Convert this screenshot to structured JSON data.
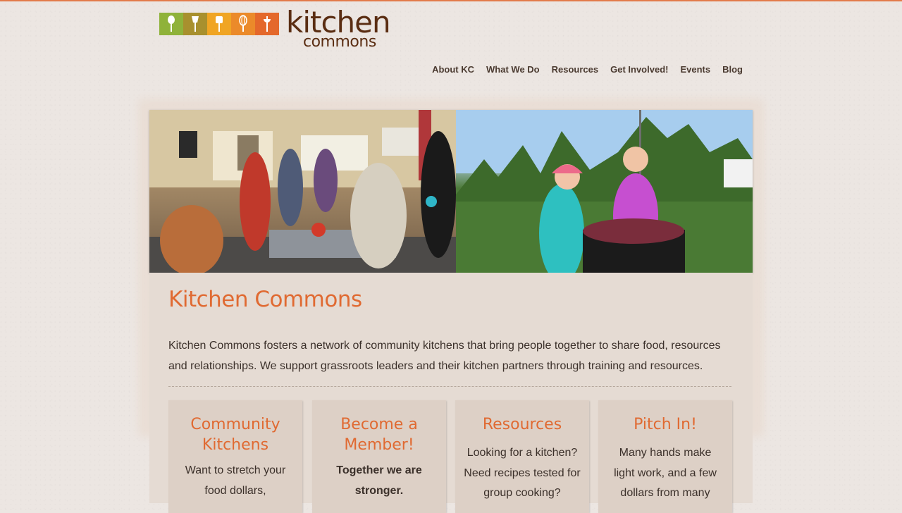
{
  "logo": {
    "word1": "kitchen",
    "word2": "commons",
    "tiles": [
      {
        "icon": "spoon-icon",
        "color": "#8fb23a"
      },
      {
        "icon": "brush-icon",
        "color": "#a8902e"
      },
      {
        "icon": "spatula-icon",
        "color": "#f0a524"
      },
      {
        "icon": "whisk-icon",
        "color": "#eb8a2a"
      },
      {
        "icon": "ladle-icon",
        "color": "#e4682b"
      }
    ]
  },
  "nav": {
    "items": [
      "About KC",
      "What We Do",
      "Resources",
      "Get Involved!",
      "Events",
      "Blog"
    ]
  },
  "main": {
    "title": "Kitchen Commons",
    "intro": "Kitchen Commons fosters a network of community kitchens that bring people together to share food, resources and relationships. We support grassroots leaders and their kitchen partners through training and resources."
  },
  "cards": [
    {
      "title": "Community Kitchens",
      "text": "Want to stretch your food dollars,",
      "bold": false
    },
    {
      "title": "Become a Member!",
      "text": "Together we are stronger.",
      "bold": true
    },
    {
      "title": "Resources",
      "text": "Looking for a kitchen? Need recipes tested for group cooking?",
      "bold": false
    },
    {
      "title": "Pitch In!",
      "text": "Many hands make light work, and a few dollars from many",
      "bold": false
    }
  ],
  "colors": {
    "accent": "#e06a32",
    "brand_brown": "#5a2d12",
    "top_rule": "#e27b4a"
  }
}
